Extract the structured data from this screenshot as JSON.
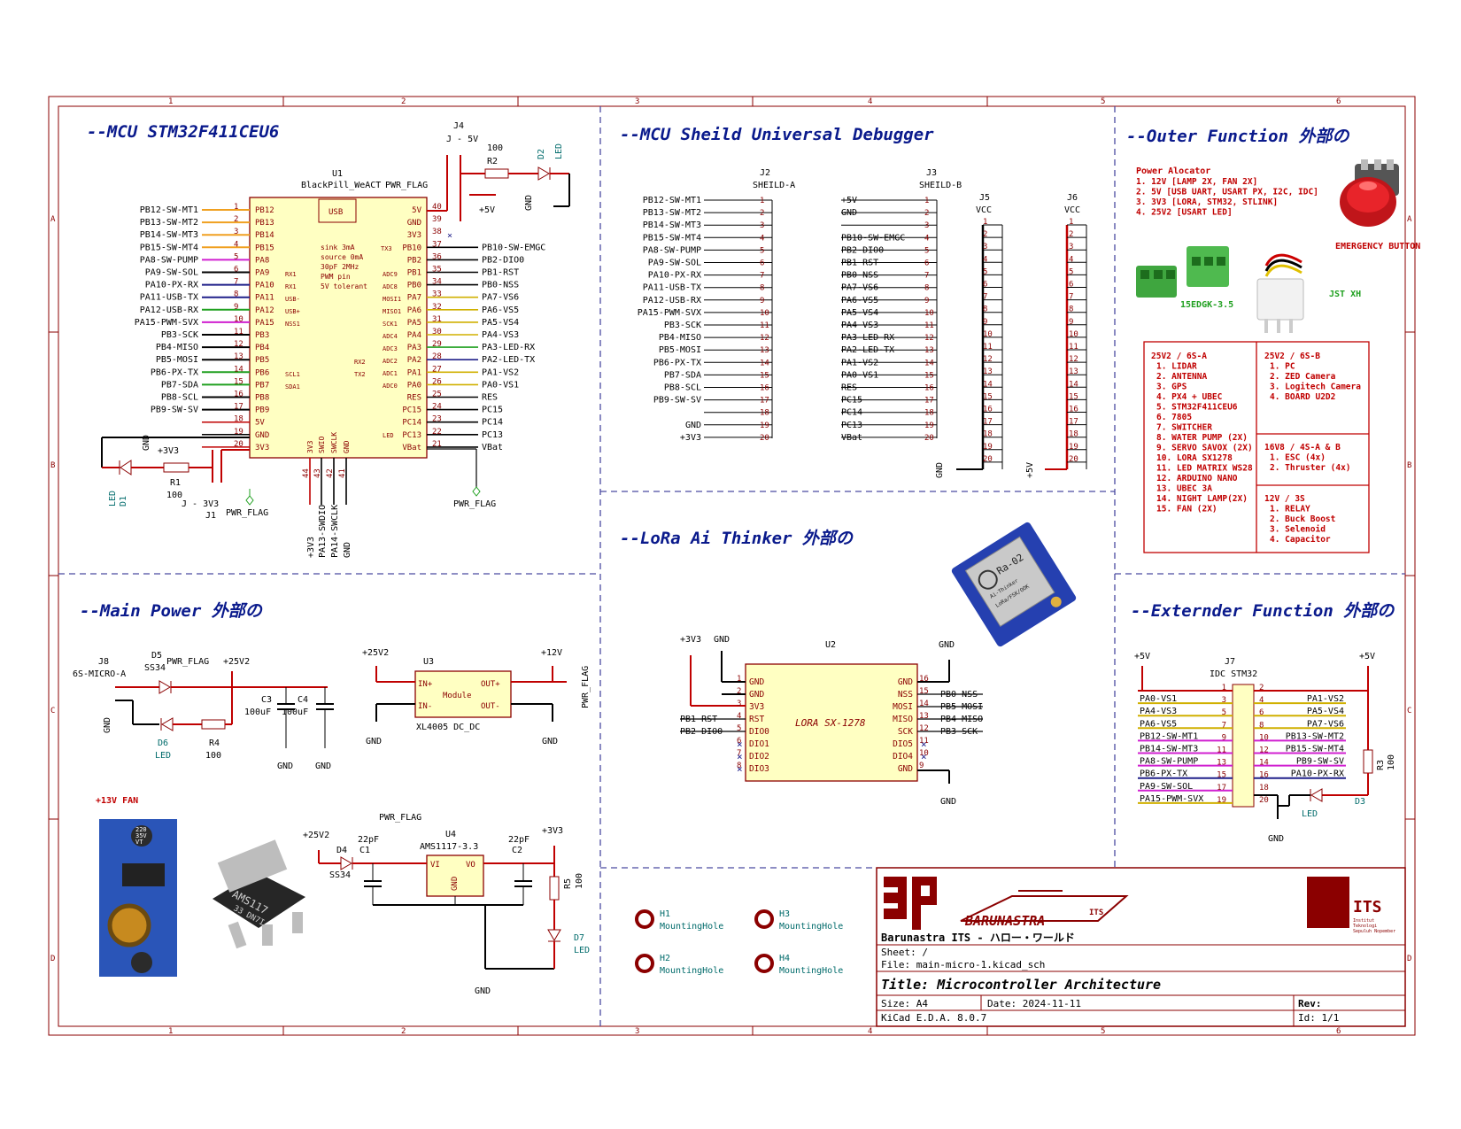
{
  "sections": {
    "mcu": "--MCU STM32F411CEU6",
    "shield": "--MCU Sheild Universal Debugger",
    "outer": "--Outer Function 外部の",
    "lora": "--LoRa Ai Thinker 外部の",
    "power": "--Main Power 外部の",
    "extender": "--Externder Function 外部の"
  },
  "border": {
    "cols": [
      "1",
      "2",
      "3",
      "4",
      "5",
      "6"
    ],
    "rows": [
      "A",
      "B",
      "C",
      "D"
    ]
  },
  "u1": {
    "ref": "U1",
    "value": "BlackPill_WeACT",
    "usb": "USB",
    "left_nets": [
      "PB12-SW-MT1",
      "PB13-SW-MT2",
      "PB14-SW-MT3",
      "PB15-SW-MT4",
      "PA8-SW-PUMP",
      "PA9-SW-SOL",
      "PA10-PX-RX",
      "PA11-USB-TX",
      "PA12-USB-RX",
      "PA15-PWM-SVX",
      "PB3-SCK",
      "PB4-MISO",
      "PB5-MOSI",
      "PB6-PX-TX",
      "PB7-SDA",
      "PB8-SCL",
      "PB9-SW-SV"
    ],
    "left_pins": [
      "PB12",
      "PB13",
      "PB14",
      "PB15",
      "PA8",
      "PA9",
      "PA10",
      "PA11",
      "PA12",
      "PA15",
      "PB3",
      "PB4",
      "PB5",
      "PB6",
      "PB7",
      "PB8",
      "PB9",
      "5V",
      "GND",
      "3V3"
    ],
    "left_nums": [
      "1",
      "2",
      "3",
      "4",
      "5",
      "6",
      "7",
      "8",
      "9",
      "10",
      "11",
      "12",
      "13",
      "14",
      "15",
      "16",
      "17",
      "18",
      "19",
      "20"
    ],
    "right_pins": [
      "5V",
      "GND",
      "3V3",
      "PB10",
      "PB2",
      "PB1",
      "PB0",
      "PA7",
      "PA6",
      "PA5",
      "PA4",
      "PA3",
      "PA2",
      "PA1",
      "PA0",
      "RES",
      "PC15",
      "PC14",
      "PC13",
      "VBat"
    ],
    "right_nums": [
      "40",
      "39",
      "38",
      "37",
      "36",
      "35",
      "34",
      "33",
      "32",
      "31",
      "30",
      "29",
      "28",
      "27",
      "26",
      "25",
      "24",
      "23",
      "22",
      "21"
    ],
    "right_nets": [
      "",
      "",
      "",
      "PB10-SW-EMGC",
      "PB2-DIO0",
      "PB1-RST",
      "PB0-NSS",
      "PA7-VS6",
      "PA6-VS5",
      "PA5-VS4",
      "PA4-VS3",
      "PA3-LED-RX",
      "PA2-LED-TX",
      "PA1-VS2",
      "PA0-VS1",
      "RES",
      "PC15",
      "PC14",
      "PC13",
      "VBat"
    ],
    "note": [
      "sink 3mA",
      "source 0mA",
      "30pF 2MHz",
      "PWM pin",
      "5V tolerant"
    ],
    "alt": [
      "TX3",
      "ADC9",
      "ADC8",
      "MOSI1",
      "MISO1",
      "SCK1",
      "ADC4",
      "ADC3",
      "ADC2",
      "ADC1",
      "ADC0",
      "LED",
      "RX1",
      "RX1",
      "USB-",
      "USB+",
      "NSS1",
      "SCL1",
      "SDA1",
      "RX2",
      "TX2"
    ],
    "bottom": [
      "3V3",
      "SWIO",
      "SWCLK",
      "GND"
    ],
    "bottom_nums": [
      "44",
      "43",
      "42",
      "41"
    ],
    "bottom_nets": [
      "+3V3",
      "PA13-SWDIO",
      "PA14-SWCLK",
      "GND"
    ]
  },
  "j4": {
    "ref": "J4",
    "value": "J - 5V",
    "r2": "R2",
    "r2v": "100",
    "d2": "D2",
    "d2v": "LED",
    "p5": "+5V",
    "gnd": "GND",
    "flag": "PWR_FLAG"
  },
  "j1": {
    "ref": "J1",
    "value": "J - 3V3",
    "r1": "R1",
    "r1v": "100",
    "d1": "D1",
    "d1v": "LED",
    "p3": "+3V3",
    "gnd": "GND",
    "flag": "PWR_FLAG"
  },
  "vbat_flag": "PWR_FLAG",
  "j2": {
    "ref": "J2",
    "value": "SHEILD-A",
    "nets": [
      "PB12-SW-MT1",
      "PB13-SW-MT2",
      "PB14-SW-MT3",
      "PB15-SW-MT4",
      "PA8-SW-PUMP",
      "PA9-SW-SOL",
      "PA10-PX-RX",
      "PA11-USB-TX",
      "PA12-USB-RX",
      "PA15-PWM-SVX",
      "PB3-SCK",
      "PB4-MISO",
      "PB5-MOSI",
      "PB6-PX-TX",
      "PB7-SDA",
      "PB8-SCL",
      "PB9-SW-SV",
      "",
      "GND",
      "+3V3"
    ],
    "nums": [
      "1",
      "2",
      "3",
      "4",
      "5",
      "6",
      "7",
      "8",
      "9",
      "10",
      "11",
      "12",
      "13",
      "14",
      "15",
      "16",
      "17",
      "18",
      "19",
      "20"
    ]
  },
  "j3": {
    "ref": "J3",
    "value": "SHEILD-B",
    "nets": [
      "+5V",
      "GND",
      "",
      "PB10-SW-EMGC",
      "PB2-DIO0",
      "PB1-RST",
      "PB0-NSS",
      "PA7-VS6",
      "PA6-VS5",
      "PA5-VS4",
      "PA4-VS3",
      "PA3-LED-RX",
      "PA2-LED-TX",
      "PA1-VS2",
      "PA0-VS1",
      "RES",
      "PC15",
      "PC14",
      "PC13",
      "VBat"
    ],
    "nums": [
      "1",
      "2",
      "3",
      "4",
      "5",
      "6",
      "7",
      "8",
      "9",
      "10",
      "11",
      "12",
      "13",
      "14",
      "15",
      "16",
      "17",
      "18",
      "19",
      "20"
    ]
  },
  "j5": {
    "ref": "J5",
    "value": "VCC",
    "gnd": "GND"
  },
  "j6": {
    "ref": "J6",
    "value": "VCC",
    "p5": "+5V"
  },
  "outer": {
    "alloc_title": "Power Alocator",
    "alloc": [
      "1. 12V [LAMP 2X, FAN 2X]",
      "2. 5V [USB UART, USART PX, I2C, IDC]",
      "3. 3V3 [LORA, STM32, STLINK]",
      "4. 25V2 [USART LED]"
    ],
    "emergency": "EMERGENCY BUTTON",
    "terminal": "15EDGK-3.5",
    "jst": "JST XH",
    "box_a_title": "25V2 / 6S-A",
    "box_a": [
      "1. LIDAR",
      "2. ANTENNA",
      "3. GPS",
      "4. PX4 + UBEC",
      "5. STM32F411CEU6",
      "6. 7805",
      "7. SWITCHER",
      "8. WATER PUMP (2X)",
      "9. SERVO SAVOX (2X)",
      "10. LORA SX1278",
      "11. LED MATRIX WS28",
      "12. ARDUINO NANO",
      "13. UBEC 3A",
      "14. NIGHT LAMP(2X)",
      "15. FAN (2X)"
    ],
    "box_b_title": "25V2 / 6S-B",
    "box_b": [
      "1. PC",
      "2. ZED Camera",
      "3. Logitech Camera",
      "4. BOARD U2D2"
    ],
    "box_c_title": "16V8 / 4S-A & B",
    "box_c": [
      "1. ESC (4x)",
      "2. Thruster (4x)"
    ],
    "box_d_title": "12V / 3S",
    "box_d": [
      "1. RELAY",
      "2. Buck Boost",
      "3. Selenoid",
      "4. Capacitor"
    ]
  },
  "lora": {
    "ref": "U2",
    "value": "LORA SX-1278",
    "p3": "+3V3",
    "gnd": "GND",
    "left_pins": [
      "GND",
      "GND",
      "3V3",
      "RST",
      "DIO0",
      "DIO1",
      "DIO2",
      "DIO3"
    ],
    "left_nums": [
      "1",
      "2",
      "3",
      "4",
      "5",
      "6",
      "7",
      "8"
    ],
    "left_nets": [
      "",
      "",
      "",
      "PB1-RST",
      "PB2-DIO0",
      "",
      "",
      ""
    ],
    "right_pins": [
      "GND",
      "NSS",
      "MOSI",
      "MISO",
      "SCK",
      "DIO5",
      "DIO4",
      "GND"
    ],
    "right_nums": [
      "16",
      "15",
      "14",
      "13",
      "12",
      "11",
      "10",
      "9"
    ],
    "right_nets": [
      "",
      "PB0-NSS",
      "PB5-MOSI",
      "PB4-MISO",
      "PB3-SCK",
      "",
      "",
      ""
    ],
    "module_text": [
      "Ra-02",
      "Ai-Thinker",
      "LoRa/FSK/OOK"
    ]
  },
  "power": {
    "j8": "J8",
    "j8v": "6S-MICRO-A",
    "d5": "D5",
    "d5v": "SS34",
    "flag": "PWR_FLAG",
    "p25": "+25V2",
    "c3": "C3",
    "c3v": "100uF",
    "c4": "C4",
    "c4v": "100uF",
    "d6": "D6",
    "d6v": "LED",
    "r4": "R4",
    "r4v": "100",
    "gnd": "GND",
    "u3": "U3",
    "u3v": "XL4005 DC_DC",
    "module": "Module",
    "inp": "IN+",
    "inn": "IN-",
    "outp": "OUT+",
    "outn": "OUT-",
    "p12": "+12V",
    "fan": "+13V FAN",
    "d4": "D4",
    "d4v": "SS34",
    "c1": "C1",
    "c1v": "22pF",
    "c2": "C2",
    "c2v": "22pF",
    "u4": "U4",
    "u4v": "AMS1117-3.3",
    "vi": "VI",
    "vo": "VO",
    "ugnd": "GND",
    "p33": "+3V3",
    "r5": "R5",
    "r5v": "100",
    "d7": "D7",
    "d7v": "LED",
    "buck_caps": [
      "220",
      "35V",
      "VT"
    ],
    "ams_chip": [
      "AMS117",
      "33  DN7I"
    ]
  },
  "holes": [
    {
      "ref": "H1",
      "value": "MountingHole"
    },
    {
      "ref": "H3",
      "value": "MountingHole"
    },
    {
      "ref": "H2",
      "value": "MountingHole"
    },
    {
      "ref": "H4",
      "value": "MountingHole"
    }
  ],
  "extender": {
    "ref": "J7",
    "value": "IDC STM32",
    "p5a": "+5V",
    "p5b": "+5V",
    "r3": "R3",
    "r3v": "100",
    "d3": "D3",
    "d3v": "LED",
    "gnd": "GND",
    "left_nets": [
      "",
      "",
      "PA0-VS1",
      "PA4-VS3",
      "PA6-VS5",
      "PB12-SW-MT1",
      "PB14-SW-MT3",
      "PA8-SW-PUMP",
      "PB6-PX-TX",
      "PA9-SW-SOL",
      "PA15-PWM-SVX"
    ],
    "left_nums": [
      "1",
      "3",
      "5",
      "7",
      "9",
      "11",
      "13",
      "15",
      "17",
      "19"
    ],
    "right_nets": [
      "",
      "PA1-VS2",
      "PA5-VS4",
      "PA7-VS6",
      "PB13-SW-MT2",
      "PB15-SW-MT4",
      "PB9-SW-SV",
      "PA10-PX-RX",
      "",
      ""
    ],
    "right_nums": [
      "2",
      "4",
      "6",
      "8",
      "10",
      "12",
      "14",
      "16",
      "18",
      "20"
    ]
  },
  "titleblock": {
    "org": "Barunastra ITS - ハロー・ワールド",
    "logo_name": "BARUNASTRA",
    "logo_its": "ITS",
    "uni": "ITS",
    "uni_sub": [
      "Institut",
      "Teknologi",
      "Sepuluh Nopember"
    ],
    "sheet": "Sheet: /",
    "file": "File: main-micro-1.kicad_sch",
    "title": "Title: Microcontroller Architecture",
    "size": "Size: A4",
    "date": "Date: 2024-11-11",
    "rev": "Rev:",
    "kicad": "KiCad E.D.A. 8.0.7",
    "id": "Id: 1/1"
  },
  "colors": {
    "frame": "#8b0000",
    "wire": "#c00000",
    "title": "#0a1a8c",
    "ref": "#006b6b",
    "ic_fill": "#ffffc2",
    "dash": "#4a4aa0",
    "outer_box": "#c00000"
  },
  "wire_colors": [
    "#f0a020",
    "#f0a020",
    "#f0a020",
    "#f0a020",
    "#d020d0",
    "#000000",
    "#20208a",
    "#20208a",
    "#20a020",
    "#d020d0",
    "#000000",
    "#000000",
    "#000000",
    "#20a020",
    "#20a020",
    "#000000",
    "#000000"
  ],
  "ext_colors": [
    "#d0b000",
    "#d0b000",
    "#d0b000",
    "#d020d0",
    "#d020d0",
    "#d020d0",
    "#20208a",
    "#d020d0",
    "#d0b000"
  ]
}
